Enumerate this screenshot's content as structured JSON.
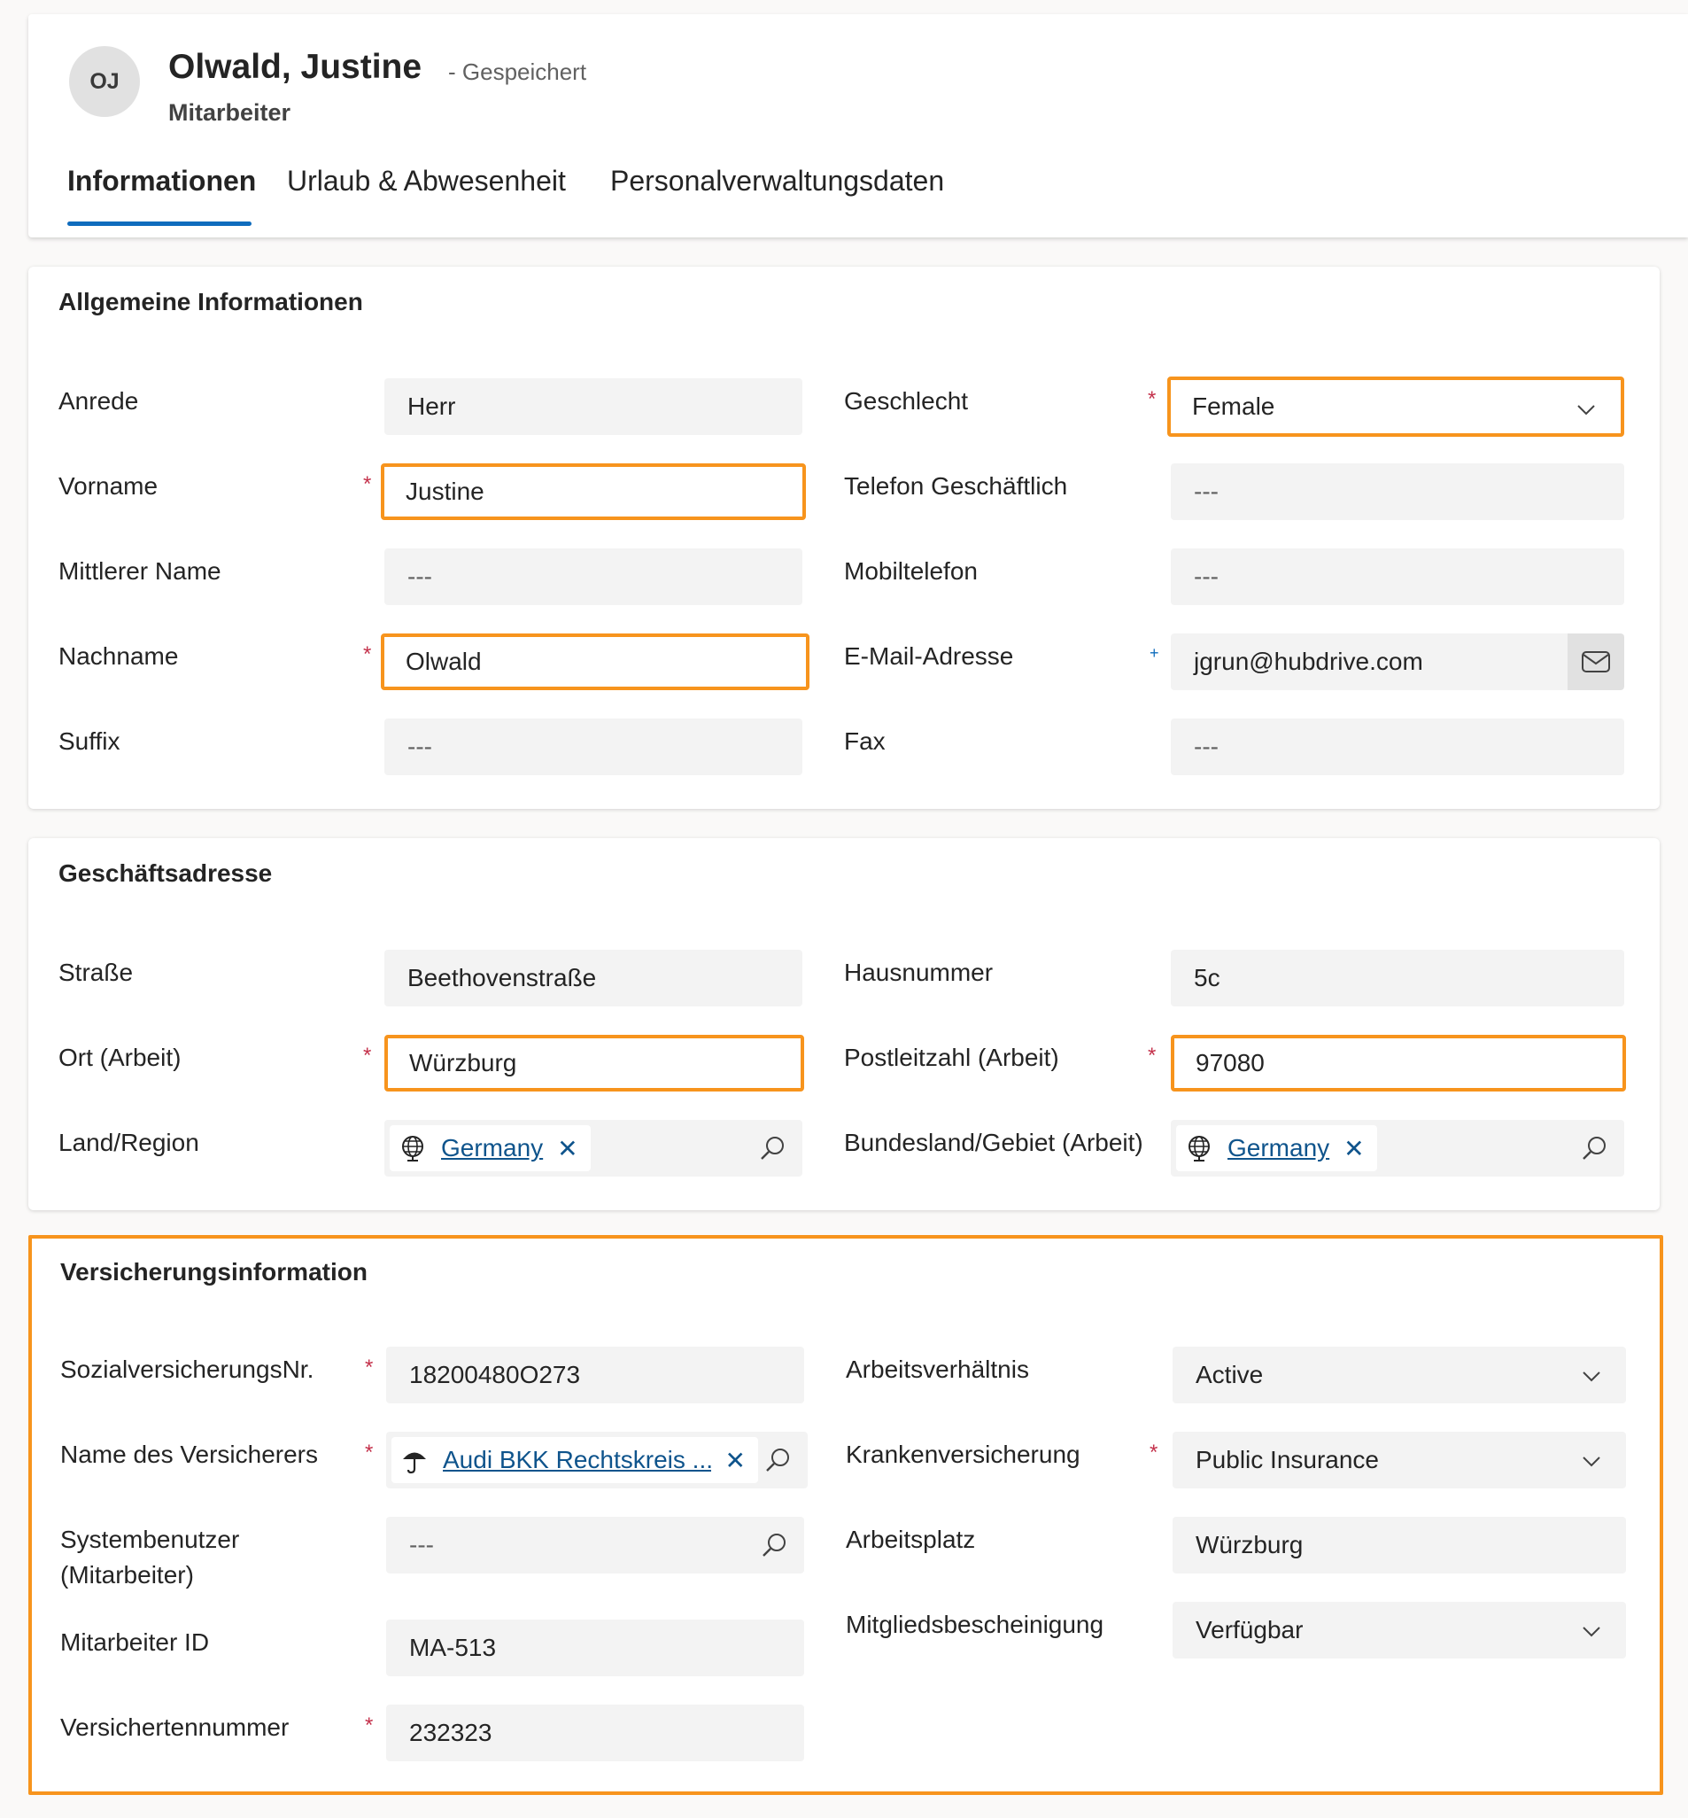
{
  "record": {
    "initials": "OJ",
    "title": "Olwald, Justine",
    "status": "- Gespeichert",
    "entity": "Mitarbeiter"
  },
  "tabs": [
    {
      "label": "Informationen",
      "active": true
    },
    {
      "label": "Urlaub & Abwesenheit",
      "active": false
    },
    {
      "label": "Personalverwaltungsdaten",
      "active": false
    }
  ],
  "general": {
    "title": "Allgemeine Informationen",
    "anrede": {
      "label": "Anrede",
      "value": "Herr"
    },
    "vorname": {
      "label": "Vorname",
      "value": "Justine"
    },
    "mittlerer": {
      "label": "Mittlerer Name",
      "value": "---"
    },
    "nachname": {
      "label": "Nachname",
      "value": "Olwald"
    },
    "suffix": {
      "label": "Suffix",
      "value": "---"
    },
    "geschlecht": {
      "label": "Geschlecht",
      "value": "Female"
    },
    "telefon": {
      "label": "Telefon Geschäftlich",
      "value": "---"
    },
    "mobil": {
      "label": "Mobiltelefon",
      "value": "---"
    },
    "email": {
      "label": "E-Mail-Adresse",
      "value": "jgrun@hubdrive.com"
    },
    "fax": {
      "label": "Fax",
      "value": "---"
    }
  },
  "address": {
    "title": "Geschäftsadresse",
    "strasse": {
      "label": "Straße",
      "value": "Beethovenstraße"
    },
    "ort": {
      "label": "Ort (Arbeit)",
      "value": "Würzburg"
    },
    "land": {
      "label": "Land/Region",
      "value": "Germany"
    },
    "hausnummer": {
      "label": "Hausnummer",
      "value": "5c"
    },
    "plz": {
      "label": "Postleitzahl (Arbeit)",
      "value": "97080"
    },
    "bundesland": {
      "label": "Bundesland/Gebiet (Arbeit)",
      "value": "Germany"
    }
  },
  "insurance": {
    "title": "Versicherungsinformation",
    "svnr": {
      "label": "SozialversicherungsNr.",
      "value": "18200480O273"
    },
    "versicherer": {
      "label": "Name des Versicherers",
      "value": "Audi BKK Rechtskreis ..."
    },
    "systembenutzer": {
      "label_line1": "Systembenutzer",
      "label_line2": "(Mitarbeiter)",
      "value": "---"
    },
    "mitarbeiterid": {
      "label": "Mitarbeiter ID",
      "value": "MA-513"
    },
    "versichertennr": {
      "label": "Versichertennummer",
      "value": "232323"
    },
    "arbeitsverhaeltnis": {
      "label": "Arbeitsverhältnis",
      "value": "Active"
    },
    "krankenversicherung": {
      "label": "Krankenversicherung",
      "value": "Public Insurance"
    },
    "arbeitsplatz": {
      "label": "Arbeitsplatz",
      "value": "Würzburg"
    },
    "mitglied": {
      "label": "Mitgliedsbescheinigung",
      "value": "Verfügbar"
    }
  },
  "required_mark": "*",
  "recommended_mark": "+",
  "icons": {
    "dropdown": "chevron-down-icon",
    "lookup": "search-icon",
    "email": "mail-icon",
    "country": "globe-icon",
    "insurer": "umbrella-icon",
    "remove": "close-icon"
  },
  "colors": {
    "highlight": "#f7941d",
    "accent": "#0f6cbd",
    "required": "#c4314b",
    "link": "#0f548c"
  }
}
